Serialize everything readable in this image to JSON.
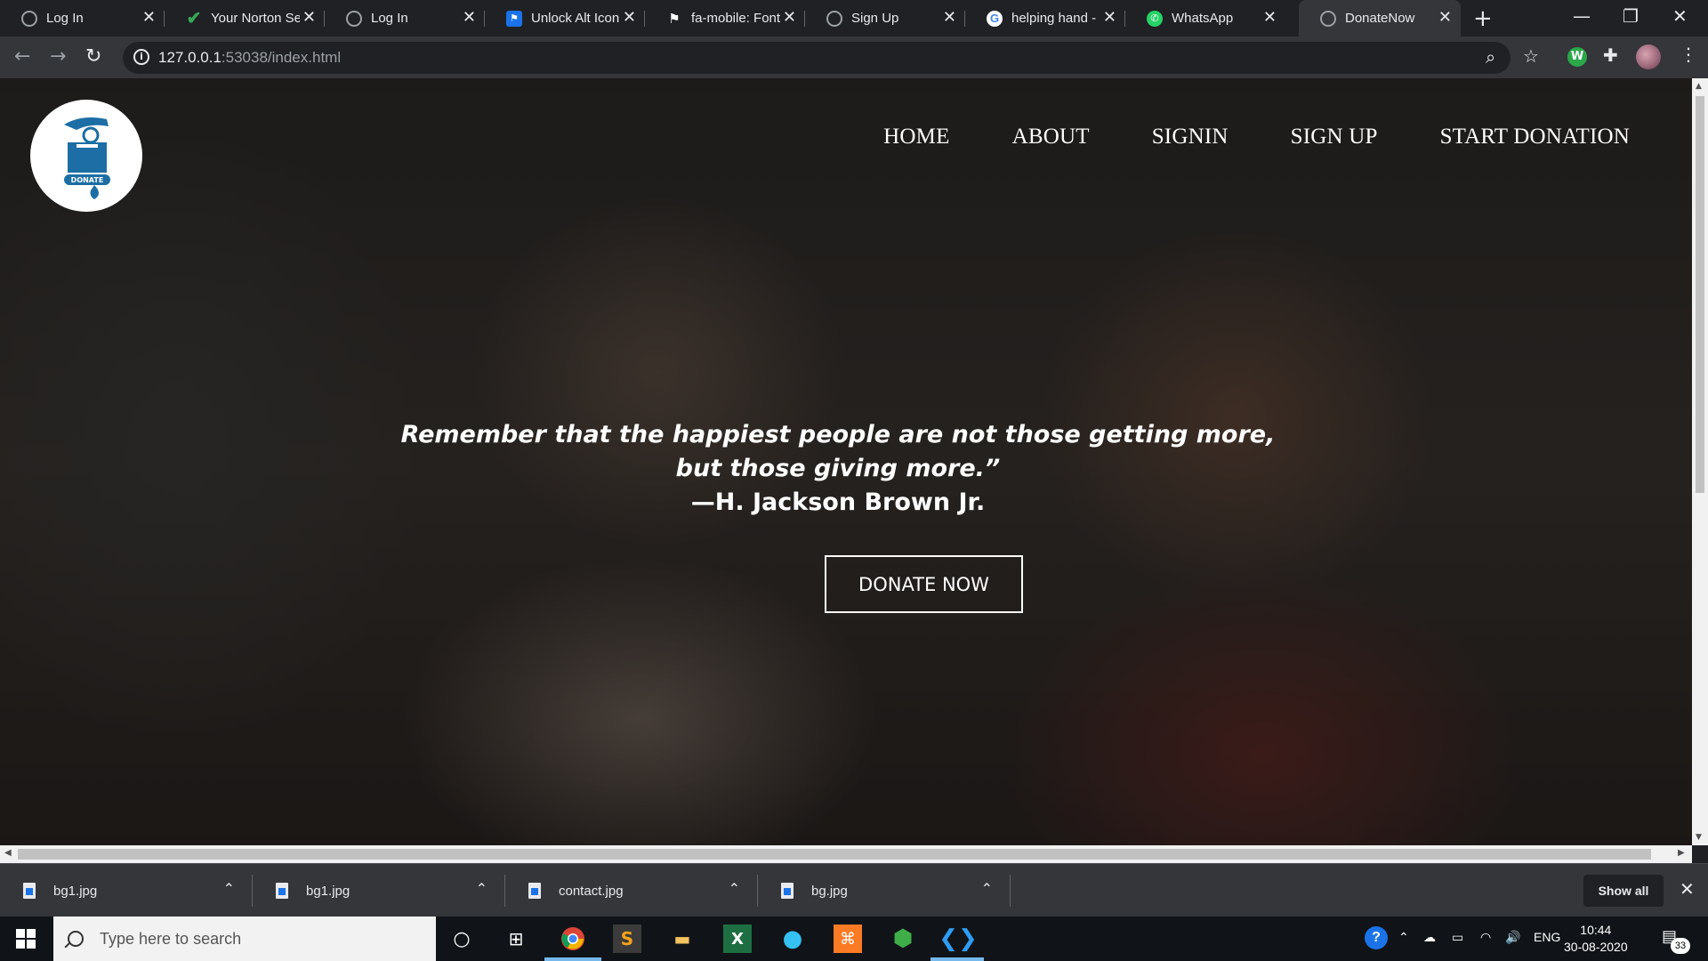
{
  "browser": {
    "tabs": [
      {
        "title": "Log In",
        "icon": "globe-icon"
      },
      {
        "title": "Your Norton Se",
        "icon": "check-icon"
      },
      {
        "title": "Log In",
        "icon": "globe-icon"
      },
      {
        "title": "Unlock Alt Icon",
        "icon": "flag-icon"
      },
      {
        "title": "fa-mobile: Font",
        "icon": "flag-icon"
      },
      {
        "title": "Sign Up",
        "icon": "globe-icon"
      },
      {
        "title": "helping hand -",
        "icon": "google-icon"
      },
      {
        "title": "WhatsApp",
        "icon": "whatsapp-icon"
      },
      {
        "title": "DonateNow",
        "icon": "globe-icon"
      }
    ],
    "url_host": "127.0.0.1",
    "url_path": ":53038/index.html"
  },
  "site": {
    "logo_text": "DONATE",
    "nav": [
      "HOME",
      "ABOUT",
      "SIGNIN",
      "SIGN UP",
      "START DONATION"
    ],
    "quote_line1": "Remember that the happiest people are not those getting more,",
    "quote_line2": "but those giving more.”",
    "author": "—H. Jackson Brown Jr.",
    "cta": "DONATE NOW"
  },
  "downloads": {
    "items": [
      "bg1.jpg",
      "bg1.jpg",
      "contact.jpg",
      "bg.jpg"
    ],
    "show_all": "Show all"
  },
  "taskbar": {
    "search_placeholder": "Type here to search",
    "language": "ENG",
    "time": "10:44",
    "date": "30-08-2020",
    "notification_count": "33"
  }
}
